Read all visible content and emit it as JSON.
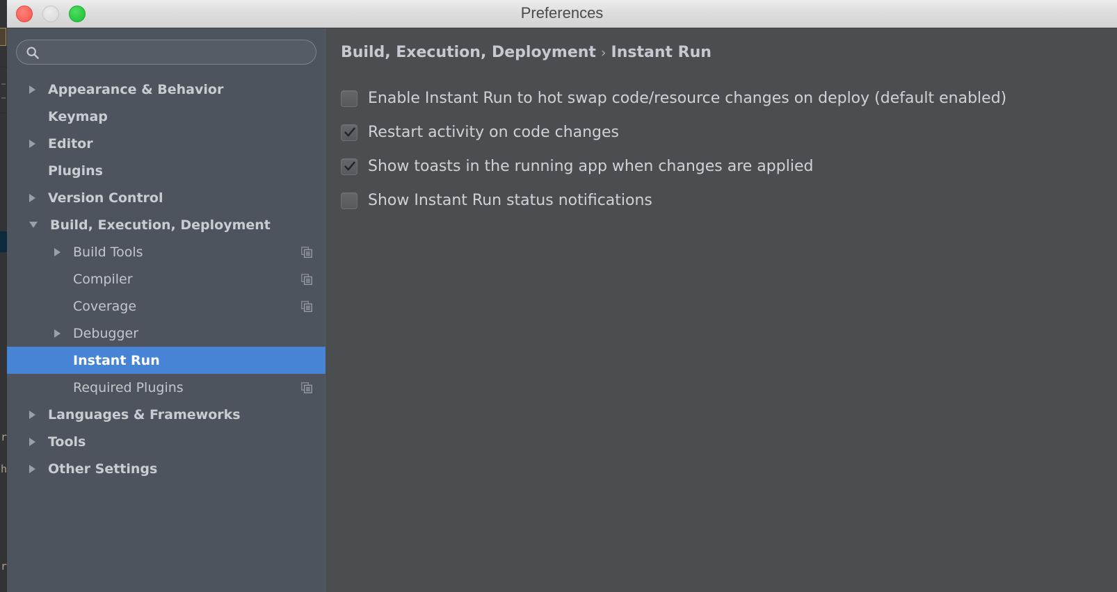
{
  "window": {
    "title": "Preferences",
    "traffic_lights": [
      {
        "name": "close",
        "color": "#f9564c"
      },
      {
        "name": "minimize",
        "color": "#d8d8d8"
      },
      {
        "name": "zoom",
        "color": "#1cbd33"
      }
    ]
  },
  "search": {
    "value": "",
    "placeholder": "",
    "icon": "search-icon"
  },
  "sidebar": {
    "accent_color": "#4784d6",
    "background": "#4e545e",
    "items": [
      {
        "label": "Appearance & Behavior",
        "level": 0,
        "arrow": "closed",
        "selected": false,
        "copy_icon": false
      },
      {
        "label": "Keymap",
        "level": 0,
        "arrow": "none",
        "selected": false,
        "copy_icon": false
      },
      {
        "label": "Editor",
        "level": 0,
        "arrow": "closed",
        "selected": false,
        "copy_icon": false
      },
      {
        "label": "Plugins",
        "level": 0,
        "arrow": "none",
        "selected": false,
        "copy_icon": false
      },
      {
        "label": "Version Control",
        "level": 0,
        "arrow": "closed",
        "selected": false,
        "copy_icon": false
      },
      {
        "label": "Build, Execution, Deployment",
        "level": 0,
        "arrow": "open",
        "selected": false,
        "copy_icon": false
      },
      {
        "label": "Build Tools",
        "level": 1,
        "arrow": "closed",
        "selected": false,
        "copy_icon": true
      },
      {
        "label": "Compiler",
        "level": 1,
        "arrow": "none",
        "selected": false,
        "copy_icon": true
      },
      {
        "label": "Coverage",
        "level": 1,
        "arrow": "none",
        "selected": false,
        "copy_icon": true
      },
      {
        "label": "Debugger",
        "level": 1,
        "arrow": "closed",
        "selected": false,
        "copy_icon": false
      },
      {
        "label": "Instant Run",
        "level": 1,
        "arrow": "none",
        "selected": true,
        "copy_icon": false
      },
      {
        "label": "Required Plugins",
        "level": 1,
        "arrow": "none",
        "selected": false,
        "copy_icon": true
      },
      {
        "label": "Languages & Frameworks",
        "level": 0,
        "arrow": "closed",
        "selected": false,
        "copy_icon": false
      },
      {
        "label": "Tools",
        "level": 0,
        "arrow": "closed",
        "selected": false,
        "copy_icon": false
      },
      {
        "label": "Other Settings",
        "level": 0,
        "arrow": "closed",
        "selected": false,
        "copy_icon": false
      }
    ]
  },
  "main": {
    "breadcrumb": {
      "parent": "Build, Execution, Deployment",
      "separator": "›",
      "current": "Instant Run"
    },
    "options": [
      {
        "label": "Enable Instant Run to hot swap code/resource changes on deploy (default enabled)",
        "checked": false
      },
      {
        "label": "Restart activity on code changes",
        "checked": true
      },
      {
        "label": "Show toasts in the running app when changes are applied",
        "checked": true
      },
      {
        "label": "Show Instant Run status notifications",
        "checked": false
      }
    ]
  }
}
